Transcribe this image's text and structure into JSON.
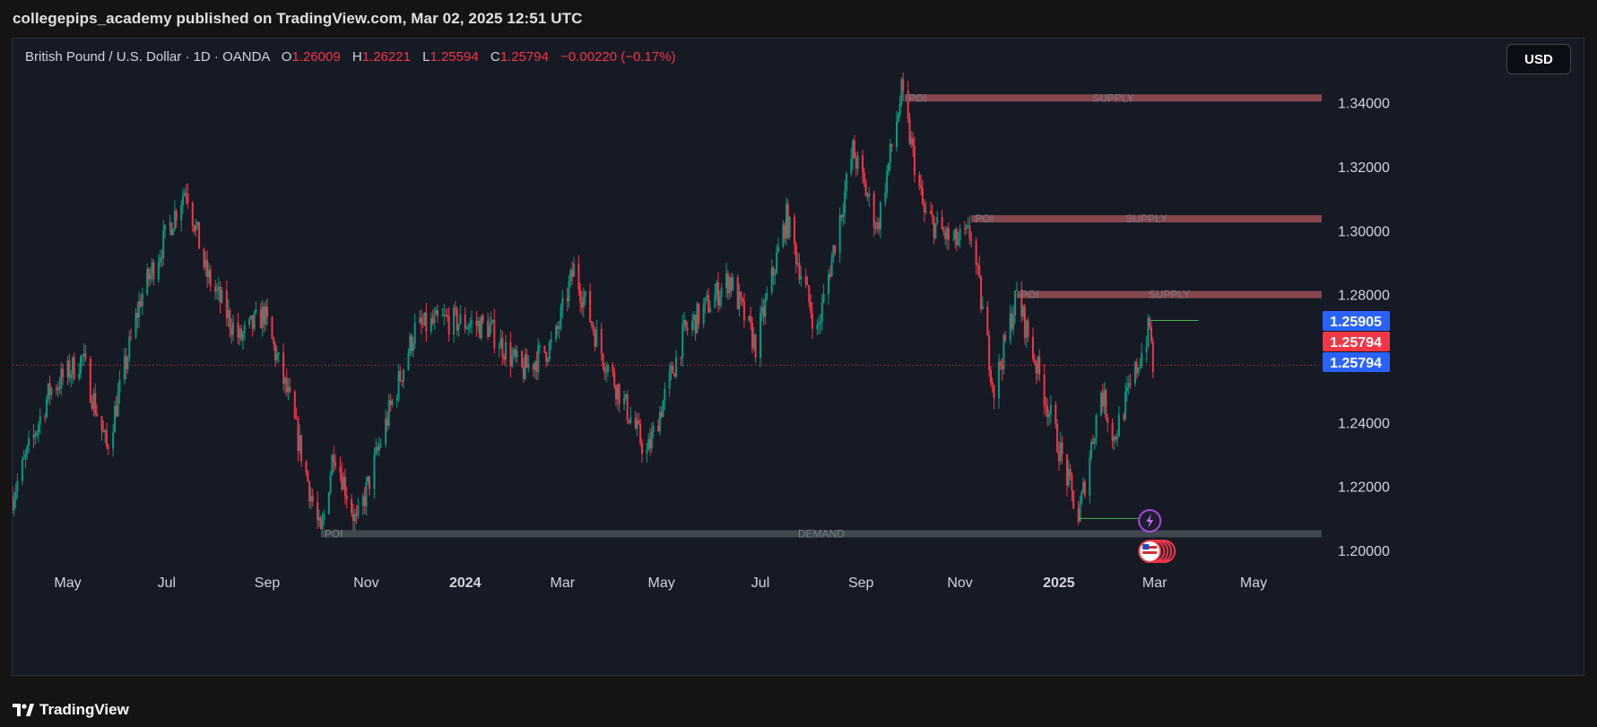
{
  "header": {
    "published_text": "collegepips_academy published on TradingView.com, Mar 02, 2025 12:51 UTC"
  },
  "legend": {
    "symbol_text": "British Pound / U.S. Dollar · 1D · OANDA",
    "o_label": "O",
    "o_value": "1.26009",
    "h_label": "H",
    "h_value": "1.26221",
    "l_label": "L",
    "l_value": "1.25594",
    "c_label": "C",
    "c_value": "1.25794",
    "change": "−0.00220 (−0.17%)"
  },
  "currency_button": "USD",
  "footer": {
    "brand": "TradingView",
    "icon": "tradingview-logo-icon"
  },
  "colors": {
    "background": "#161a25",
    "up_candle": "#089981",
    "down_candle": "#f23645",
    "supply_zone": "#8c4a4f",
    "demand_zone": "#414b50",
    "badge_blue": "#2962ff",
    "badge_red": "#f23645",
    "green_line": "#4caf50"
  },
  "chart_data": {
    "type": "candlestick",
    "symbol": "British Pound / U.S. Dollar",
    "interval": "1D",
    "source": "OANDA",
    "y_axis": {
      "position": "right",
      "range": [
        1.192,
        1.353
      ],
      "ticks": [
        "1.34000",
        "1.32000",
        "1.30000",
        "1.28000",
        "1.24000",
        "1.22000",
        "1.20000"
      ]
    },
    "x_axis": {
      "ticks": [
        {
          "label": "May",
          "date": "2023-05-01",
          "bold": false
        },
        {
          "label": "Jul",
          "date": "2023-07-01",
          "bold": false
        },
        {
          "label": "Sep",
          "date": "2023-09-01",
          "bold": false
        },
        {
          "label": "Nov",
          "date": "2023-11-01",
          "bold": false
        },
        {
          "label": "2024",
          "date": "2024-01-01",
          "bold": true
        },
        {
          "label": "Mar",
          "date": "2024-03-01",
          "bold": false
        },
        {
          "label": "May",
          "date": "2024-05-01",
          "bold": false
        },
        {
          "label": "Jul",
          "date": "2024-07-01",
          "bold": false
        },
        {
          "label": "Sep",
          "date": "2024-09-01",
          "bold": false
        },
        {
          "label": "Nov",
          "date": "2024-11-01",
          "bold": false
        },
        {
          "label": "2025",
          "date": "2025-01-01",
          "bold": true
        },
        {
          "label": "Mar",
          "date": "2025-03-01",
          "bold": false
        },
        {
          "label": "May",
          "date": "2025-05-01",
          "bold": false
        }
      ],
      "range": [
        "2023-03-28",
        "2025-06-12"
      ]
    },
    "price_path": [
      {
        "date": "2023-03-28",
        "price": 1.217
      },
      {
        "date": "2023-04-20",
        "price": 1.25
      },
      {
        "date": "2023-05-10",
        "price": 1.26
      },
      {
        "date": "2023-05-25",
        "price": 1.232
      },
      {
        "date": "2023-06-15",
        "price": 1.279
      },
      {
        "date": "2023-07-13",
        "price": 1.314
      },
      {
        "date": "2023-07-25",
        "price": 1.287
      },
      {
        "date": "2023-08-15",
        "price": 1.266
      },
      {
        "date": "2023-08-30",
        "price": 1.274
      },
      {
        "date": "2023-09-15",
        "price": 1.246
      },
      {
        "date": "2023-10-04",
        "price": 1.204
      },
      {
        "date": "2023-10-12",
        "price": 1.232
      },
      {
        "date": "2023-10-26",
        "price": 1.208
      },
      {
        "date": "2023-11-15",
        "price": 1.243
      },
      {
        "date": "2023-12-01",
        "price": 1.269
      },
      {
        "date": "2023-12-20",
        "price": 1.272
      },
      {
        "date": "2024-01-15",
        "price": 1.27
      },
      {
        "date": "2024-02-05",
        "price": 1.256
      },
      {
        "date": "2024-02-25",
        "price": 1.265
      },
      {
        "date": "2024-03-08",
        "price": 1.288
      },
      {
        "date": "2024-03-25",
        "price": 1.262
      },
      {
        "date": "2024-04-22",
        "price": 1.23
      },
      {
        "date": "2024-05-15",
        "price": 1.268
      },
      {
        "date": "2024-06-12",
        "price": 1.285
      },
      {
        "date": "2024-06-28",
        "price": 1.264
      },
      {
        "date": "2024-07-17",
        "price": 1.304
      },
      {
        "date": "2024-08-05",
        "price": 1.268
      },
      {
        "date": "2024-08-27",
        "price": 1.325
      },
      {
        "date": "2024-09-11",
        "price": 1.301
      },
      {
        "date": "2024-09-26",
        "price": 1.343
      },
      {
        "date": "2024-10-10",
        "price": 1.305
      },
      {
        "date": "2024-10-28",
        "price": 1.296
      },
      {
        "date": "2024-11-08",
        "price": 1.299
      },
      {
        "date": "2024-11-22",
        "price": 1.25
      },
      {
        "date": "2024-12-06",
        "price": 1.28
      },
      {
        "date": "2024-12-23",
        "price": 1.249
      },
      {
        "date": "2025-01-13",
        "price": 1.21
      },
      {
        "date": "2025-01-27",
        "price": 1.25
      },
      {
        "date": "2025-02-04",
        "price": 1.235
      },
      {
        "date": "2025-02-26",
        "price": 1.27
      },
      {
        "date": "2025-02-28",
        "price": 1.2579
      }
    ],
    "zones": [
      {
        "type": "supply",
        "label_left": "POI",
        "label_center": "SUPPLY",
        "price": 1.3415,
        "start": "2024-09-28",
        "end": "2025-06-12"
      },
      {
        "type": "supply",
        "label_left": "POI",
        "label_center": "SUPPLY",
        "price": 1.3037,
        "start": "2024-11-08",
        "end": "2025-06-12"
      },
      {
        "type": "supply",
        "label_left": "POI",
        "label_center": "SUPPLY",
        "price": 1.28,
        "start": "2024-12-06",
        "end": "2025-06-12"
      },
      {
        "type": "demand",
        "label_left": "POI",
        "label_center": "DEMAND",
        "price": 1.2052,
        "start": "2023-10-04",
        "end": "2025-06-12"
      }
    ],
    "lines": [
      {
        "color": "green",
        "price": 1.2719,
        "start": "2025-02-26",
        "end": "2025-03-28"
      },
      {
        "color": "green",
        "price": 1.21,
        "start": "2025-01-13",
        "end": "2025-02-20"
      },
      {
        "color": "red",
        "style": "dotted",
        "price": 1.25794,
        "start": "2023-03-28",
        "end": "2025-06-12"
      }
    ],
    "price_labels": [
      {
        "value": "1.25905",
        "color": "blue"
      },
      {
        "value": "1.25794",
        "color": "red"
      },
      {
        "value": "1.25794",
        "color": "blue"
      }
    ],
    "markers": [
      {
        "type": "event",
        "icon": "lightning-icon",
        "date": "2025-02-26"
      },
      {
        "type": "economic",
        "icon": "us-flag-icon",
        "date": "2025-02-26"
      }
    ]
  }
}
